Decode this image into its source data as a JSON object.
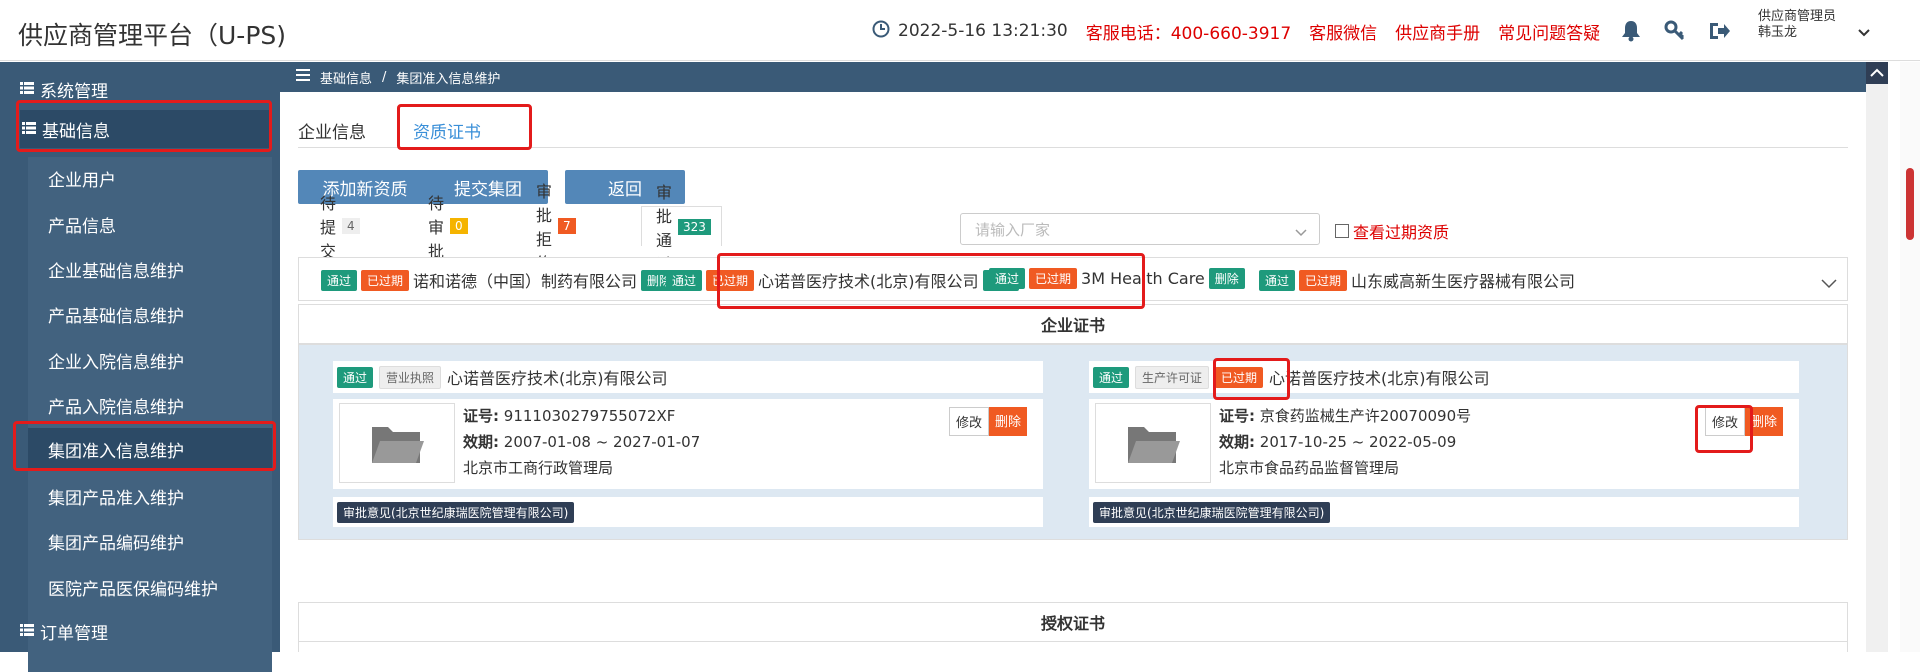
{
  "header": {
    "title": "供应商管理平台（U-PS)",
    "datetime": "2022-5-16  13:21:30",
    "hotline_label": "客服电话：",
    "hotline_number": "400-660-3917",
    "wechat": "客服微信",
    "manual": "供应商手册",
    "faq": "常见问题答疑",
    "user_role": "供应商管理员",
    "user_name": "韩玉龙"
  },
  "sidebar": {
    "groups": [
      {
        "label": "系统管理"
      },
      {
        "label": "基础信息"
      },
      {
        "label": "订单管理"
      }
    ],
    "items": [
      {
        "label": "企业用户"
      },
      {
        "label": "产品信息"
      },
      {
        "label": "企业基础信息维护"
      },
      {
        "label": "产品基础信息维护"
      },
      {
        "label": "企业入院信息维护"
      },
      {
        "label": "产品入院信息维护"
      },
      {
        "label": "集团准入信息维护"
      },
      {
        "label": "集团产品准入维护"
      },
      {
        "label": "集团产品编码维护"
      },
      {
        "label": "医院产品医保编码维护"
      }
    ]
  },
  "breadcrumb": {
    "root": "基础信息",
    "sep": "/",
    "current": "集团准入信息维护"
  },
  "tabs": {
    "company": "企业信息",
    "cert": "资质证书"
  },
  "buttons": {
    "add": "添加新资质",
    "submit": "提交集团",
    "back": "返回"
  },
  "status_tabs": [
    {
      "label": "待提交",
      "count": "4"
    },
    {
      "label": "待审批",
      "count": "0"
    },
    {
      "label": "审批拒绝",
      "count": "7"
    },
    {
      "label": "审批通过",
      "count": "323"
    }
  ],
  "search": {
    "placeholder": "请输入厂家"
  },
  "expired_checkbox": "查看过期资质",
  "tag_labels": {
    "pass": "通过",
    "expired": "已过期",
    "delete": "删除",
    "edit": "修改"
  },
  "vendors": [
    {
      "name": "诺和诺德（中国）制药有限公司"
    },
    {
      "name": "心诺普医疗技术(北京)有限公司"
    },
    {
      "name": "3M Health Care"
    },
    {
      "name": "山东威高新生医疗器械有限公司"
    }
  ],
  "sections": {
    "enterprise": "企业证书",
    "auth": "授权证书"
  },
  "certs": [
    {
      "type": "营业执照",
      "company": "心诺普医疗技术(北京)有限公司",
      "no_label": "证号:",
      "no": "9111030279755072XF",
      "valid_label": "效期:",
      "valid": "2007-01-08 ~ 2027-01-07",
      "issuer": "北京市工商行政管理局",
      "opinion": "审批意见(北京世纪康瑞医院管理有限公司)"
    },
    {
      "type": "生产许可证",
      "company": "心诺普医疗技术(北京)有限公司",
      "no_label": "证号:",
      "no": "京食药监械生产许20070090号",
      "valid_label": "效期:",
      "valid": "2017-10-25 ~ 2022-05-09",
      "issuer": "北京市食品药品监督管理局",
      "opinion": "审批意见(北京世纪康瑞医院管理有限公司)"
    }
  ],
  "colors": {
    "sidebar": "#3a5a77",
    "accent": "#5387b8",
    "pass": "#1e9a7c",
    "expired": "#f05a22",
    "highlight": "#e31b1b"
  }
}
